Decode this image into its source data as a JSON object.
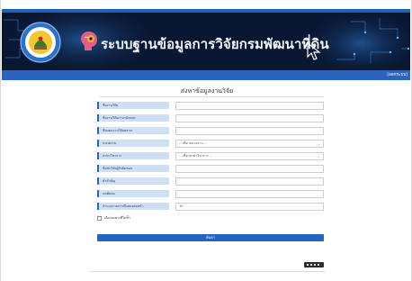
{
  "header": {
    "site_title": "ระบบฐานข้อมูลการวิจัยกรมพัฒนาที่ดิน",
    "nav_login": "[ออกระบบ]"
  },
  "form": {
    "title": "ส่งหาข้อมูลงานวิจัย",
    "fields": [
      {
        "label": "ชื่องานวิจัย",
        "type": "text",
        "value": ""
      },
      {
        "label": "ชื่องานวิจัยภาษาอังกฤษ",
        "type": "text",
        "value": ""
      },
      {
        "label": "ชื่อแผนงานวิจัยหลาย",
        "type": "text",
        "value": ""
      },
      {
        "label": "หน่วยงาน",
        "type": "select",
        "value": "-- เลือกหน่วยงาน --"
      },
      {
        "label": "สาขาวิชาการ",
        "type": "select",
        "value": "-- เลือกสาขาวิชาการ --"
      },
      {
        "label": "ชื่อนักวิจัยผู้รับผิดชอบ",
        "type": "text",
        "value": ""
      },
      {
        "label": "คำสำคัญ",
        "type": "text",
        "value": ""
      },
      {
        "label": "บทคัดย่อ",
        "type": "text",
        "value": ""
      },
      {
        "label": "จำนวนรายการที่แสดงต่อหน้า",
        "type": "text",
        "value": "10"
      }
    ],
    "checkbox_label": "เลือกเฉพาะที่ไม่ซ้ำ",
    "submit_label": "ค้นหา"
  },
  "colors": {
    "brand_blue": "#2265c0",
    "banner_navy": "#0a1733",
    "label_bg": "#cfe0f4"
  },
  "icons": [
    "agency-logo-seal",
    "brain-gear-icon",
    "cursor-icon"
  ]
}
